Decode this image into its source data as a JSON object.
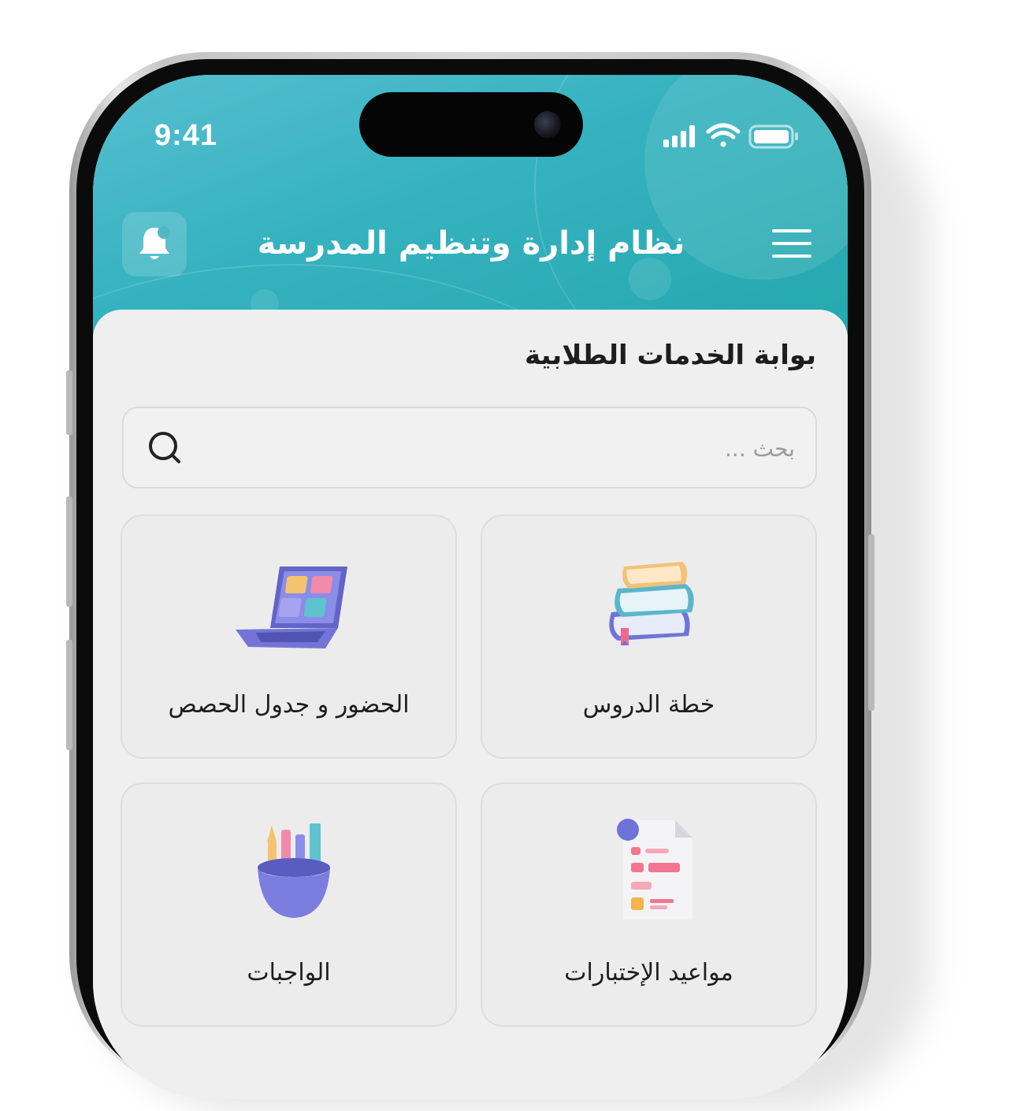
{
  "status_bar": {
    "time": "9:41",
    "icons": [
      "signal-icon",
      "wifi-icon",
      "battery-icon"
    ]
  },
  "header": {
    "title": "نظام إدارة وتنظيم المدرسة",
    "left_icon": "bell-icon",
    "right_icon": "menu-icon"
  },
  "portal": {
    "title": "بوابة الخدمات الطلابية"
  },
  "search": {
    "placeholder": "بحث ...",
    "value": ""
  },
  "services": [
    {
      "label": "خطة الدروس",
      "icon": "books-icon"
    },
    {
      "label": "الحضور و جدول الحصص",
      "icon": "laptop-icon"
    },
    {
      "label": "مواعيد الإختبارات",
      "icon": "exam-document-icon"
    },
    {
      "label": "الواجبات",
      "icon": "pencil-cup-icon"
    }
  ],
  "colors": {
    "header_start": "#56bfd0",
    "header_end": "#25a8ae",
    "background": "#efefef",
    "card": "#ececec",
    "accent_purple": "#7e7fe0"
  }
}
